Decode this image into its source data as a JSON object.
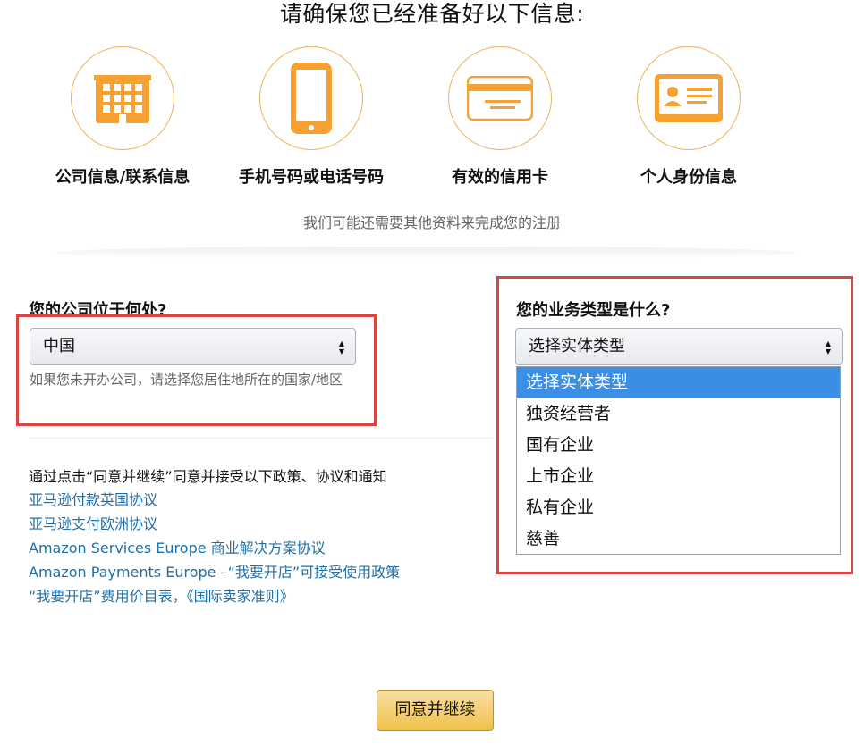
{
  "header": {
    "title": "请确保您已经准备好以下信息:"
  },
  "requirements": [
    {
      "label": "公司信息/联系信息",
      "icon": "building-icon"
    },
    {
      "label": "手机号码或电话号码",
      "icon": "mobile-phone-icon"
    },
    {
      "label": "有效的信用卡",
      "icon": "credit-card-icon"
    },
    {
      "label": "个人身份信息",
      "icon": "id-card-icon"
    }
  ],
  "note": "我们可能还需要其他资料来完成您的注册",
  "company_location": {
    "question": "您的公司位于何处?",
    "selected": "中国",
    "hint": "如果您未开办公司，请选择您居住地所在的国家/地区"
  },
  "business_type": {
    "question": "您的业务类型是什么?",
    "selected": "选择实体类型",
    "options": [
      "选择实体类型",
      "独资经营者",
      "国有企业",
      "上市企业",
      "私有企业",
      "慈善"
    ]
  },
  "agreement": {
    "text": "通过点击“同意并继续”同意并接受以下政策、协议和通知",
    "links": [
      "亚马逊付款英国协议",
      "亚马逊支付欧洲协议",
      "Amazon Services Europe 商业解决方案协议",
      "Amazon Payments Europe –“我要开店”可接受使用政策",
      "“我要开店”费用价目表，《国际卖家准则》"
    ]
  },
  "continue_button": "同意并继续",
  "colors": {
    "accent_orange": "#f7a133",
    "highlight_red": "#d9443f",
    "link_blue": "#1f6fa8",
    "selected_blue": "#3a8ee6",
    "button_gold": "#f0c14b"
  }
}
